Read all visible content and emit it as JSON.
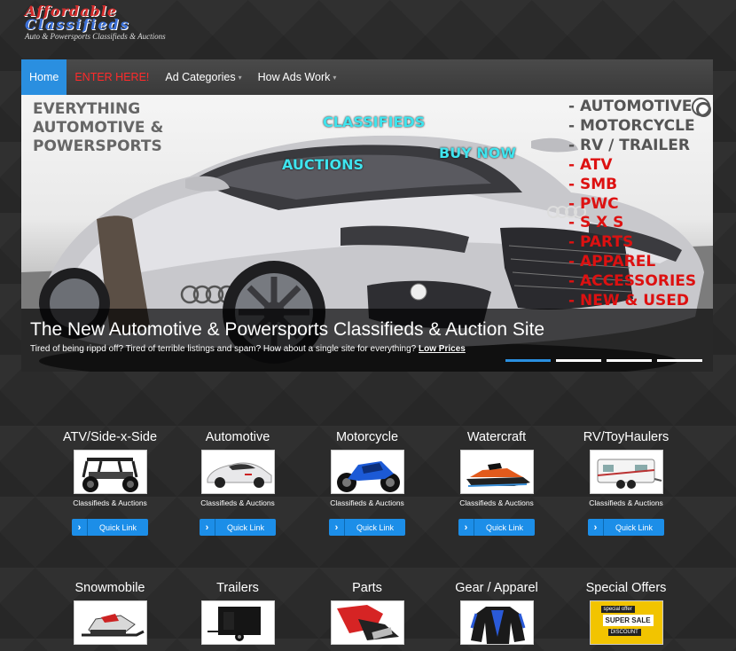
{
  "logo": {
    "line1": "Affordable",
    "line2": "Classifieds",
    "tagline": "Auto & Powersports Classifieds & Auctions"
  },
  "nav": {
    "items": [
      {
        "label": "Home"
      },
      {
        "label": "ENTER HERE!"
      },
      {
        "label": "Ad Categories"
      },
      {
        "label": "How Ads Work"
      }
    ]
  },
  "banner": {
    "left_lines": [
      "EVERYTHING",
      "AUTOMOTIVE &",
      "POWERSPORTS"
    ],
    "classifieds": "CLASSIFIEDS",
    "auctions": "AUCTIONS",
    "buy_now": "BUY NOW",
    "right_list": [
      {
        "text": "- AUTOMOTIVE",
        "color": "#555555"
      },
      {
        "text": "- MOTORCYCLE",
        "color": "#555555"
      },
      {
        "text": "- RV / TRAILER",
        "color": "#555555"
      },
      {
        "text": "- ATV",
        "color": "#dd1111"
      },
      {
        "text": "- SMB",
        "color": "#dd1111"
      },
      {
        "text": "- PWC",
        "color": "#dd1111"
      },
      {
        "text": "- S X S",
        "color": "#dd1111"
      },
      {
        "text": "- PARTS",
        "color": "#dd1111"
      },
      {
        "text": "- APPAREL",
        "color": "#dd1111"
      },
      {
        "text": "- ACCESSORIES",
        "color": "#dd1111"
      },
      {
        "text": "- NEW & USED",
        "color": "#dd1111"
      }
    ],
    "caption_title": "The New Automotive & Powersports Classifieds & Auction Site",
    "caption_text": "Tired of being rippd off? Tired of terrible listings and spam? How about a single site for everything?",
    "caption_link": "Low Prices",
    "slide_count": 4,
    "active_slide": 1
  },
  "categories": [
    {
      "title": "ATV/Side-x-Side",
      "subtitle": "Classifieds & Auctions",
      "button": "Quick Link",
      "icon": "utv-image"
    },
    {
      "title": "Automotive",
      "subtitle": "Classifieds & Auctions",
      "button": "Quick Link",
      "icon": "sports-car-image"
    },
    {
      "title": "Motorcycle",
      "subtitle": "Classifieds & Auctions",
      "button": "Quick Link",
      "icon": "motorcycle-image"
    },
    {
      "title": "Watercraft",
      "subtitle": "Classifieds & Auctions",
      "button": "Quick Link",
      "icon": "jet-ski-image"
    },
    {
      "title": "RV/ToyHaulers",
      "subtitle": "Classifieds & Auctions",
      "button": "Quick Link",
      "icon": "rv-trailer-image"
    },
    {
      "title": "Snowmobile",
      "icon": "snowmobile-image"
    },
    {
      "title": "Trailers",
      "icon": "cargo-trailer-image"
    },
    {
      "title": "Parts",
      "icon": "exhaust-part-image"
    },
    {
      "title": "Gear / Apparel",
      "icon": "riding-jacket-image"
    },
    {
      "title": "Special Offers",
      "icon": "super-sale-image",
      "sale_top": "special offer",
      "sale_main": "SUPER SALE",
      "sale_bottom": "DISCOUNT"
    }
  ]
}
